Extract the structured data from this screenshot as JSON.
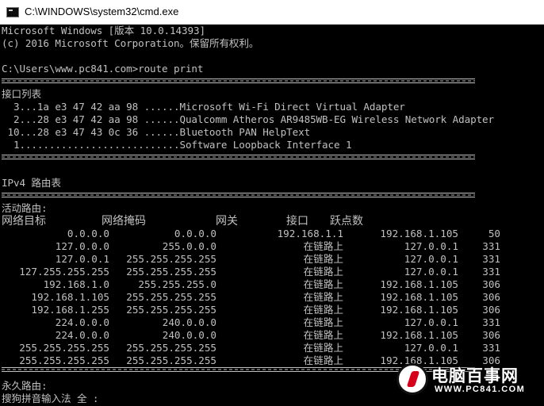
{
  "window": {
    "title": "C:\\WINDOWS\\system32\\cmd.exe"
  },
  "console": {
    "line1": "Microsoft Windows [版本 10.0.14393]",
    "line2": "(c) 2016 Microsoft Corporation。保留所有权利。",
    "prompt": "C:\\Users\\www.pc841.com>route print",
    "iface_title": "接口列表",
    "interfaces": [
      "  3...1a e3 47 42 aa 98 ......Microsoft Wi-Fi Direct Virtual Adapter",
      "  2...28 e3 47 42 aa 98 ......Qualcomm Atheros AR9485WB-EG Wireless Network Adapter",
      " 10...28 e3 47 43 0c 36 ......Bluetooth PAN HelpText",
      "  1...........................Software Loopback Interface 1"
    ],
    "ipv4_title": "IPv4 路由表",
    "active_title": "活动路由:",
    "headers": [
      "网络目标",
      "网络掩码",
      "网关",
      "接口",
      "跃点数"
    ],
    "routes": [
      [
        "0.0.0.0",
        "0.0.0.0",
        "192.168.1.1",
        "192.168.1.105",
        "50"
      ],
      [
        "127.0.0.0",
        "255.0.0.0",
        "在链路上",
        "127.0.0.1",
        "331"
      ],
      [
        "127.0.0.1",
        "255.255.255.255",
        "在链路上",
        "127.0.0.1",
        "331"
      ],
      [
        "127.255.255.255",
        "255.255.255.255",
        "在链路上",
        "127.0.0.1",
        "331"
      ],
      [
        "192.168.1.0",
        "255.255.255.0",
        "在链路上",
        "192.168.1.105",
        "306"
      ],
      [
        "192.168.1.105",
        "255.255.255.255",
        "在链路上",
        "192.168.1.105",
        "306"
      ],
      [
        "192.168.1.255",
        "255.255.255.255",
        "在链路上",
        "192.168.1.105",
        "306"
      ],
      [
        "224.0.0.0",
        "240.0.0.0",
        "在链路上",
        "127.0.0.1",
        "331"
      ],
      [
        "224.0.0.0",
        "240.0.0.0",
        "在链路上",
        "192.168.1.105",
        "306"
      ],
      [
        "255.255.255.255",
        "255.255.255.255",
        "在链路上",
        "127.0.0.1",
        "331"
      ],
      [
        "255.255.255.255",
        "255.255.255.255",
        "在链路上",
        "192.168.1.105",
        "306"
      ]
    ],
    "persistent_title": "永久路由:",
    "ime_status": "搜狗拼音输入法 全 :"
  },
  "watermark": {
    "name": "电脑百事网",
    "url": "WWW.PC841.COM"
  },
  "colors": {
    "console_bg": "#000000",
    "console_fg": "#c0c0c0",
    "titlebar_bg": "#ffffff",
    "logo_accent": "#d7001a"
  },
  "icons": {
    "window_icon": "cmd-console-icon"
  }
}
